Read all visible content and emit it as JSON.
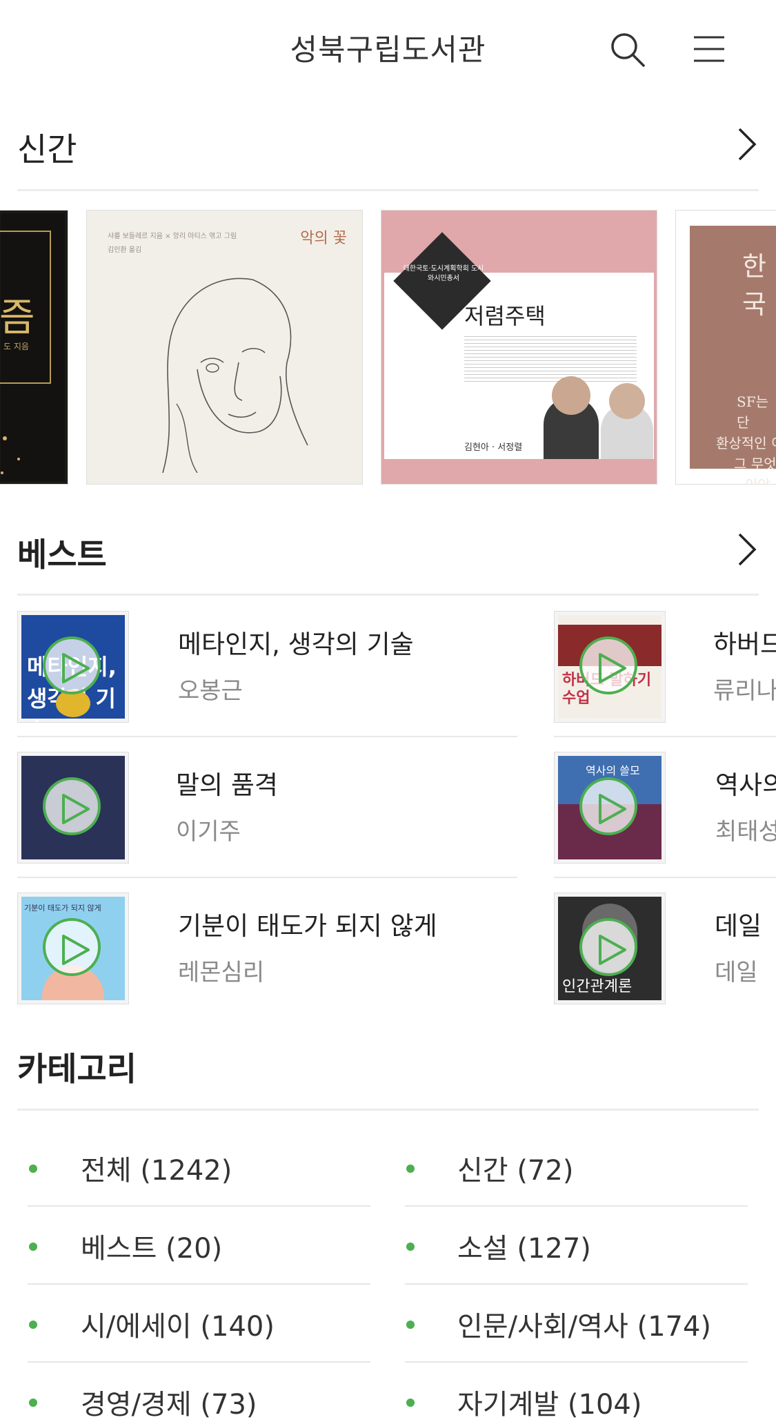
{
  "header": {
    "title": "성북구립도서관",
    "search_icon": "search-icon",
    "menu_icon": "hamburger-menu-icon"
  },
  "new_section": {
    "title": "신간",
    "books": [
      {
        "cover_title": "즘",
        "cover_author": "도 지음"
      },
      {
        "cover_title": "악의 꽃",
        "cover_author": "샤를 보들레르 지음 × 앙리 마티스 엮고 그림",
        "cover_translator": "김인환 옮김"
      },
      {
        "cover_series": "대한국토·도시계획학회 도시와시민총서",
        "cover_title": "저렴주택",
        "cover_author": "김현아 · 서정렬"
      },
      {
        "cover_title": "한국",
        "cover_text": [
          "SF는 단",
          "환상적인 이",
          "그 무엇",
          "이야"
        ]
      }
    ]
  },
  "best_section": {
    "title": "베스트",
    "items": [
      {
        "title": "메타인지, 생각의 기술",
        "author": "오봉근",
        "cover_text": "메타인지, 생각의 기술"
      },
      {
        "title": "하버드",
        "author": "류리나",
        "cover_text": "하버드 말하기 수업"
      },
      {
        "title": "말의 품격",
        "author": "이기주",
        "cover_text": ""
      },
      {
        "title": "역사의",
        "author": "최태성",
        "cover_text": "역사의 쓸모"
      },
      {
        "title": "기분이 태도가 되지 않게",
        "author": "레몬심리",
        "cover_text": "기분이 태도가 되지 않게"
      },
      {
        "title": "데일 ",
        "author": "데일 ",
        "cover_text": "인간관계론"
      }
    ]
  },
  "category_section": {
    "title": "카테고리",
    "items": [
      {
        "label": "전체 (1242)"
      },
      {
        "label": "신간 (72)"
      },
      {
        "label": "베스트 (20)"
      },
      {
        "label": "소설 (127)"
      },
      {
        "label": "시/에세이 (140)"
      },
      {
        "label": "인문/사회/역사 (174)"
      },
      {
        "label": "경영/경제 (73)"
      },
      {
        "label": "자기계발 (104)"
      }
    ]
  },
  "colors": {
    "accent": "#4caf50",
    "divider": "#ececec",
    "author_text": "#8a8a8a"
  }
}
